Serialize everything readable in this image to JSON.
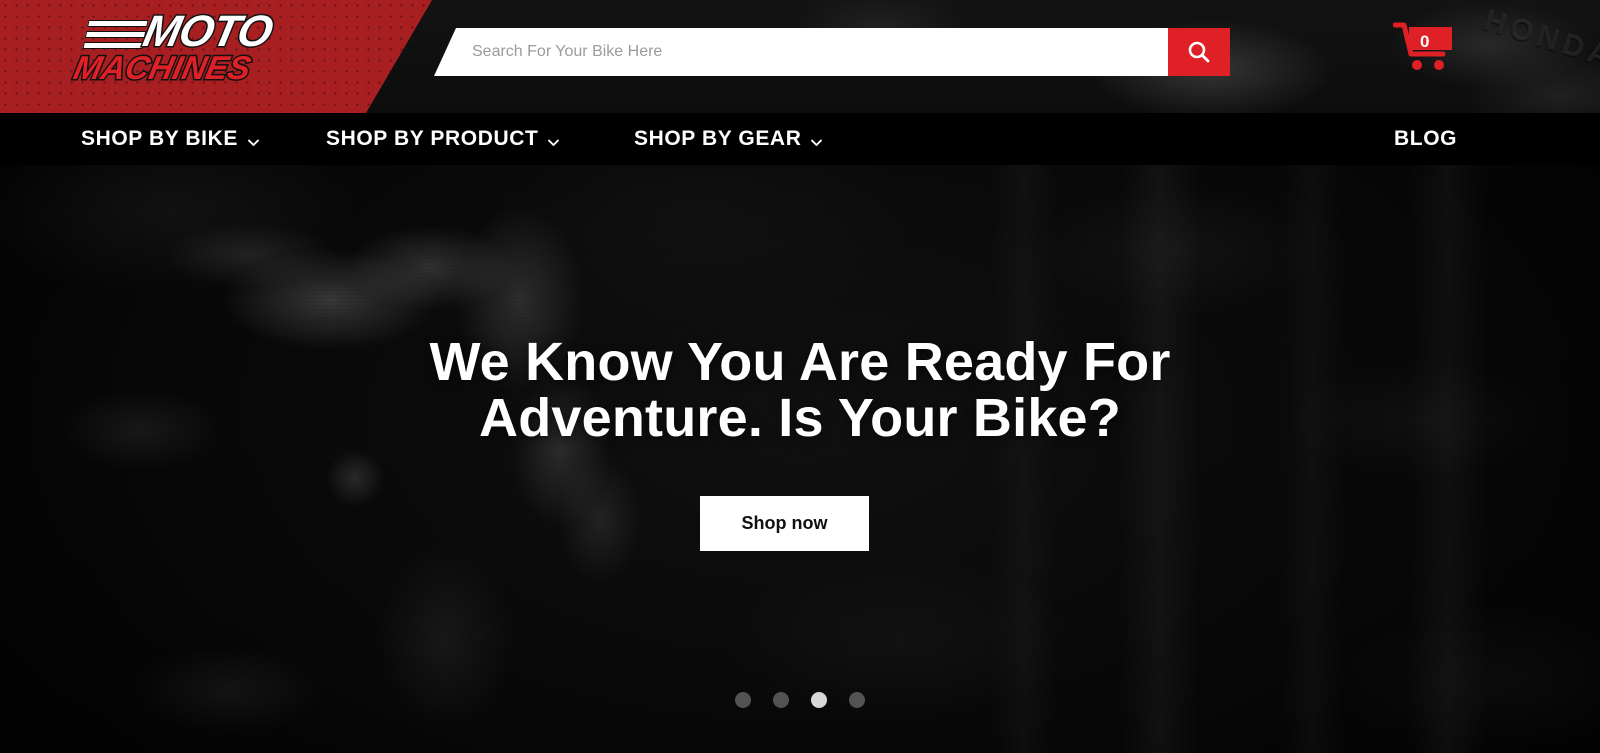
{
  "brand": {
    "logo_top": "MOTO",
    "logo_bottom": "MACHINES",
    "accent_red": "#E02027",
    "banner_red": "#A81F22"
  },
  "header": {
    "search": {
      "placeholder": "Search For Your Bike Here",
      "value": "",
      "button_icon": "search-icon"
    },
    "cart": {
      "icon": "shopping-cart-icon",
      "count": "0"
    },
    "background_watermark": "HONDA"
  },
  "nav": {
    "items": [
      {
        "label": "SHOP BY BIKE",
        "has_dropdown": true,
        "icon": "chevron-down-icon"
      },
      {
        "label": "SHOP BY PRODUCT",
        "has_dropdown": true,
        "icon": "chevron-down-icon"
      },
      {
        "label": "SHOP BY GEAR",
        "has_dropdown": true,
        "icon": "chevron-down-icon"
      },
      {
        "label": "BLOG",
        "has_dropdown": false
      }
    ]
  },
  "hero": {
    "headline_line1": "We Know You Are Ready For",
    "headline_line2": "Adventure. Is Your Bike?",
    "cta_label": "Shop now",
    "carousel": {
      "total_slides": 4,
      "active_index": 2
    }
  }
}
